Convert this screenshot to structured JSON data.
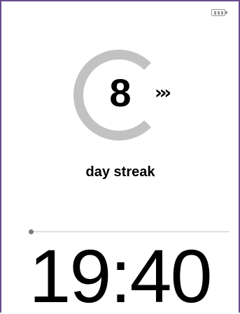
{
  "status_bar": {
    "battery_icon": "battery-icon",
    "battery_level": 3,
    "battery_max": 4
  },
  "streak": {
    "count": "8",
    "label": "day streak",
    "indicator_icon": "triple-chevron-right-icon",
    "indicator_text": "›››",
    "ring_progress": 0.75
  },
  "progress": {
    "value": 0.0
  },
  "clock": {
    "time": "19:40"
  },
  "colors": {
    "frame": "#6a4a8e",
    "ring": "#c2c2c2",
    "text": "#000000",
    "divider": "#c4c4c4",
    "dot": "#7a7a7a"
  }
}
